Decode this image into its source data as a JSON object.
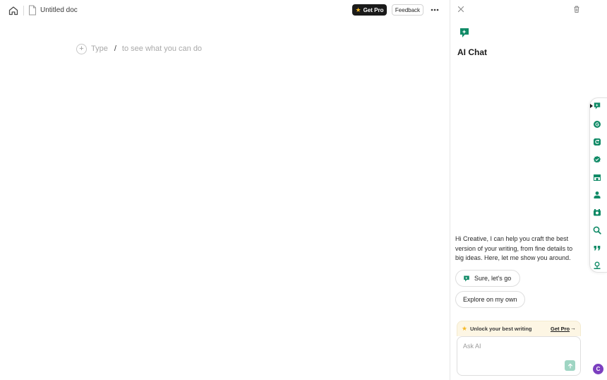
{
  "colors": {
    "accent": "#0f8a66",
    "pro_badge_bg": "#1a1a1a",
    "star": "#f5b928",
    "avatar_bg": "#7b3fbf"
  },
  "topbar": {
    "doc_title": "Untitled doc",
    "get_pro_label": "Get Pro",
    "feedback_label": "Feedback",
    "icons": [
      "home-icon",
      "document-icon",
      "more-icon"
    ]
  },
  "editor": {
    "placeholder_type": "Type",
    "placeholder_slash": "/",
    "placeholder_rest": "to see what you can do"
  },
  "panel": {
    "title": "AI Chat",
    "intro": "Hi Creative, I can help you craft the best version of your writing, from fine details to big ideas. Here, let me show you around.",
    "chip_go": "Sure, let's go",
    "chip_explore": "Explore on my own",
    "unlock_text": "Unlock your best writing",
    "unlock_link": "Get Pro",
    "unlock_arrow": "→",
    "ask_placeholder": "Ask AI"
  },
  "rail": {
    "icons": [
      "ai-chat-icon",
      "grammar-icon",
      "paraphrase-icon",
      "check-icon",
      "translate-icon",
      "humanize-icon",
      "detector-icon",
      "plagiarism-icon",
      "citation-icon",
      "expert-icon"
    ]
  },
  "avatar": {
    "initial": "C"
  }
}
